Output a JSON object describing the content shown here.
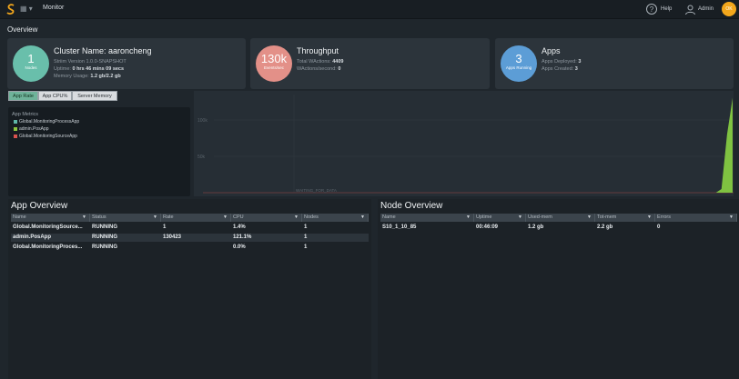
{
  "topbar": {
    "title": "Monitor",
    "menu_icon": "grid-menu-icon",
    "help_label": "Help",
    "user_label": "Admin",
    "avatar_label": "OK"
  },
  "overview": {
    "title": "Overview",
    "cluster": {
      "count": "1",
      "count_label": "Nodes",
      "title": "Cluster Name: aaroncheng",
      "version": "Striim Version 1.0.0-SNAPSHOT",
      "uptime_label": "Uptime:",
      "uptime_value": "0 hrs 46 mins 09 secs",
      "memory_label": "Memory Usage:",
      "memory_value": "1.2 gb/2.2 gb"
    },
    "throughput": {
      "count": "130k",
      "count_label": "Events/sec",
      "title": "Throughput",
      "total_label": "Total WActions:",
      "total_value": "4409",
      "rate_label": "WActions/second:",
      "rate_value": "0"
    },
    "apps": {
      "count": "3",
      "count_label": "Apps Running",
      "title": "Apps",
      "deployed_label": "Apps Deployed:",
      "deployed_value": "3",
      "created_label": "Apps Created:",
      "created_value": "3"
    }
  },
  "tabs": [
    {
      "label": "App Rate",
      "active": true
    },
    {
      "label": "App CPU%",
      "active": false
    },
    {
      "label": "Server Memory",
      "active": false
    }
  ],
  "metrics": {
    "title": "App Metrics",
    "items": [
      {
        "label": "Global.MonitoringProcessApp",
        "color": "#5fb6a8"
      },
      {
        "label": "admin.PosApp",
        "color": "#8dc63f"
      },
      {
        "label": "Global.MonitoringSourceApp",
        "color": "#d9534f"
      }
    ]
  },
  "chart_data": {
    "type": "area",
    "title": "",
    "xlabel": "",
    "ylabel": "",
    "x_tick_label": "WAITING_FOR_DATA",
    "y_tick_labels": [
      "100k",
      "50k"
    ],
    "series": [
      {
        "name": "admin.PosApp",
        "color": "#7fc241",
        "values": [
          0,
          0,
          0,
          0,
          0,
          0,
          0,
          0,
          0,
          0,
          0,
          0,
          0,
          5000,
          80000,
          130423
        ]
      }
    ],
    "ylim": [
      0,
      135000
    ]
  },
  "app_overview": {
    "title": "App Overview",
    "columns": [
      "Name",
      "Status",
      "Rate",
      "CPU",
      "Nodes"
    ],
    "rows": [
      [
        "Global.MonitoringSource...",
        "RUNNING",
        "1",
        "1.4%",
        "1"
      ],
      [
        "admin.PosApp",
        "RUNNING",
        "130423",
        "121.1%",
        "1"
      ],
      [
        "Global.MonitoringProces...",
        "RUNNING",
        "",
        "0.0%",
        "1"
      ]
    ]
  },
  "node_overview": {
    "title": "Node Overview",
    "columns": [
      "Name",
      "Uptime",
      "Used-mem",
      "Tot-mem",
      "Errors"
    ],
    "rows": [
      [
        "S10_1_10_85",
        "00:46:09",
        "1.2 gb",
        "2.2 gb",
        "0"
      ]
    ]
  }
}
